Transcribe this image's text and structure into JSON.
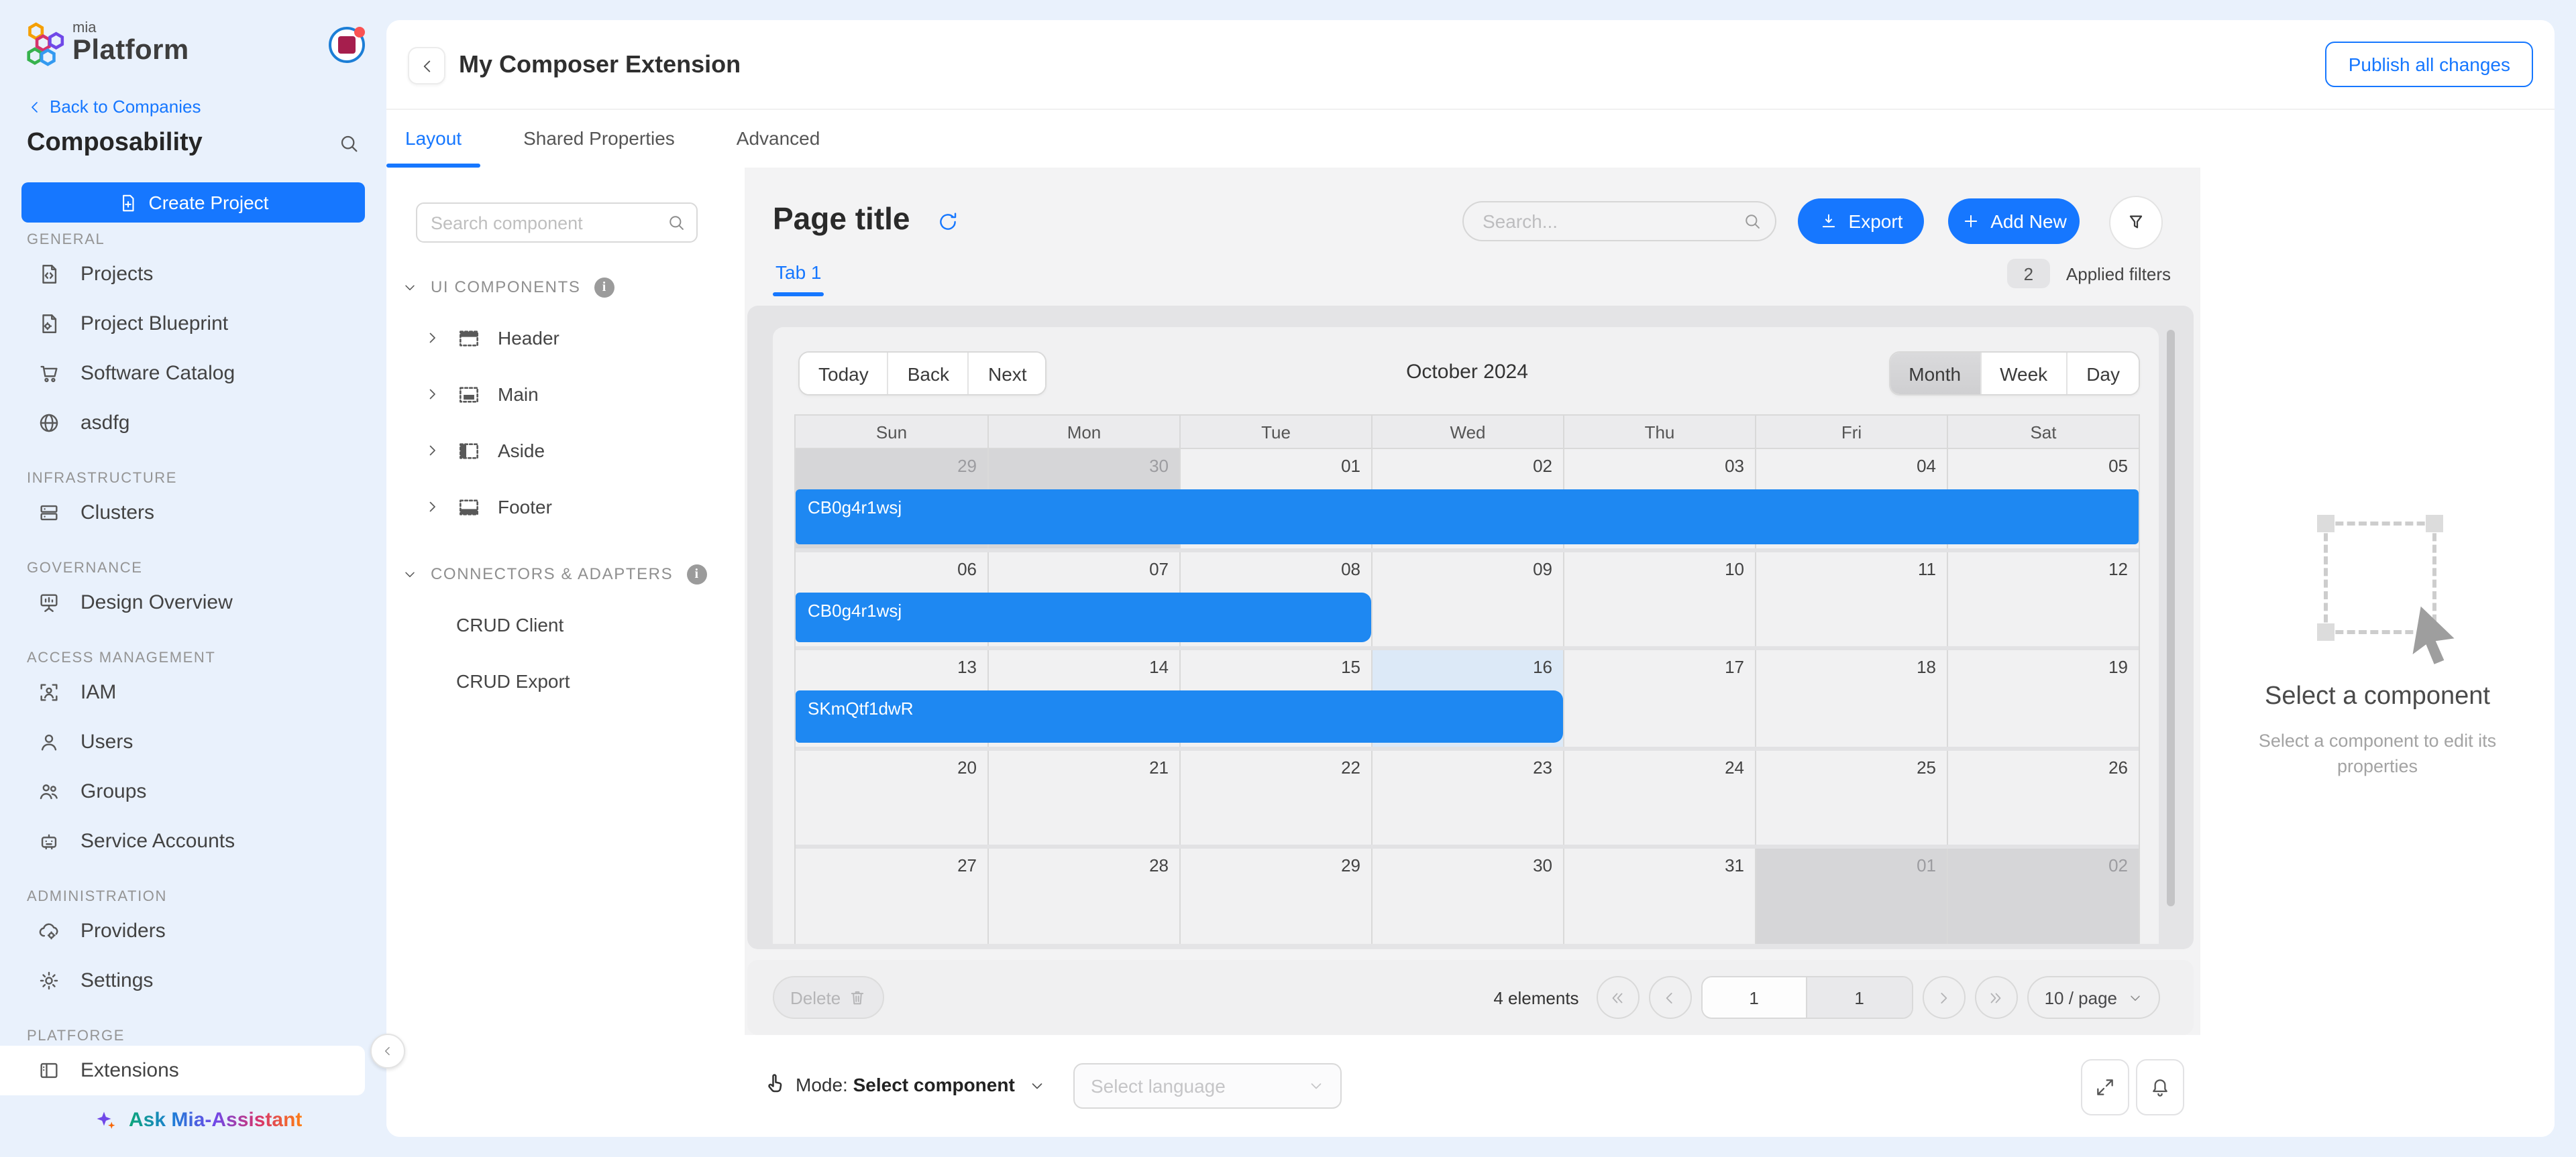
{
  "colors": {
    "accent": "#1677ff",
    "event_blue": "#1e88f2",
    "page_bg": "#e9f1fc",
    "today_cell": "#dce9f7"
  },
  "sidebar": {
    "logo": {
      "mia": "mia",
      "platform": "Platform"
    },
    "back_link": "Back to Companies",
    "company": "Composability",
    "create_project": "Create Project",
    "sections": [
      {
        "label": "GENERAL",
        "items": [
          {
            "label": "Projects",
            "icon": "file-code-icon"
          },
          {
            "label": "Project Blueprint",
            "icon": "file-gear-icon"
          },
          {
            "label": "Software Catalog",
            "icon": "cart-icon"
          },
          {
            "label": "asdfg",
            "icon": "globe-icon"
          }
        ]
      },
      {
        "label": "INFRASTRUCTURE",
        "items": [
          {
            "label": "Clusters",
            "icon": "server-icon"
          }
        ]
      },
      {
        "label": "GOVERNANCE",
        "items": [
          {
            "label": "Design Overview",
            "icon": "board-icon"
          }
        ]
      },
      {
        "label": "ACCESS MANAGEMENT",
        "items": [
          {
            "label": "IAM",
            "icon": "id-badge-icon"
          },
          {
            "label": "Users",
            "icon": "user-icon"
          },
          {
            "label": "Groups",
            "icon": "users-icon"
          },
          {
            "label": "Service Accounts",
            "icon": "robot-icon"
          }
        ]
      },
      {
        "label": "ADMINISTRATION",
        "items": [
          {
            "label": "Providers",
            "icon": "cloud-gear-icon"
          },
          {
            "label": "Settings",
            "icon": "gear-icon"
          }
        ]
      },
      {
        "label": "PLATFORGE",
        "items": [
          {
            "label": "Extensions",
            "icon": "layout-icon",
            "active": true
          }
        ]
      }
    ],
    "assistant": "Ask Mia-Assistant"
  },
  "header": {
    "title": "My Composer Extension",
    "publish_button": "Publish all changes"
  },
  "tabs": [
    {
      "label": "Layout",
      "active": true
    },
    {
      "label": "Shared Properties",
      "active": false
    },
    {
      "label": "Advanced",
      "active": false
    }
  ],
  "component_panel": {
    "search_placeholder": "Search component",
    "groups": [
      {
        "label": "UI COMPONENTS",
        "items": [
          {
            "label": "Header",
            "icon": "layout-header-icon",
            "expandable": true
          },
          {
            "label": "Main",
            "icon": "layout-main-icon",
            "expandable": true
          },
          {
            "label": "Aside",
            "icon": "layout-aside-icon",
            "expandable": true
          },
          {
            "label": "Footer",
            "icon": "layout-footer-icon",
            "expandable": true
          }
        ]
      },
      {
        "label": "CONNECTORS & ADAPTERS",
        "items": [
          {
            "label": "CRUD Client"
          },
          {
            "label": "CRUD Export"
          }
        ]
      }
    ]
  },
  "canvas": {
    "page_title": "Page title",
    "search_placeholder": "Search...",
    "export_button": "Export",
    "add_new_button": "Add New",
    "content_tab": "Tab 1",
    "applied_filters_count": "2",
    "applied_filters_label": "Applied filters"
  },
  "calendar": {
    "toolbar": {
      "today": "Today",
      "back": "Back",
      "next": "Next",
      "title": "October 2024",
      "views": [
        "Month",
        "Week",
        "Day"
      ],
      "active_view": "Month"
    },
    "weekdays": [
      "Sun",
      "Mon",
      "Tue",
      "Wed",
      "Thu",
      "Fri",
      "Sat"
    ],
    "weeks": [
      {
        "days": [
          {
            "d": "29",
            "outside": true
          },
          {
            "d": "30",
            "outside": true
          },
          {
            "d": "01"
          },
          {
            "d": "02"
          },
          {
            "d": "03"
          },
          {
            "d": "04"
          },
          {
            "d": "05"
          }
        ],
        "events": [
          {
            "label": "CB0g4r1wsj",
            "start": 0,
            "span": 7,
            "rounded_right": false
          }
        ]
      },
      {
        "days": [
          {
            "d": "06"
          },
          {
            "d": "07"
          },
          {
            "d": "08"
          },
          {
            "d": "09"
          },
          {
            "d": "10"
          },
          {
            "d": "11"
          },
          {
            "d": "12"
          }
        ],
        "events": [
          {
            "label": "CB0g4r1wsj",
            "start": 0,
            "span": 3,
            "rounded_right": true
          }
        ]
      },
      {
        "days": [
          {
            "d": "13"
          },
          {
            "d": "14"
          },
          {
            "d": "15"
          },
          {
            "d": "16",
            "today": true
          },
          {
            "d": "17"
          },
          {
            "d": "18"
          },
          {
            "d": "19"
          }
        ],
        "events": [
          {
            "label": "SKmQtf1dwR",
            "start": 0,
            "span": 4,
            "rounded_right": true
          }
        ]
      },
      {
        "days": [
          {
            "d": "20"
          },
          {
            "d": "21"
          },
          {
            "d": "22"
          },
          {
            "d": "23"
          },
          {
            "d": "24"
          },
          {
            "d": "25"
          },
          {
            "d": "26"
          }
        ],
        "events": []
      },
      {
        "days": [
          {
            "d": "27"
          },
          {
            "d": "28"
          },
          {
            "d": "29"
          },
          {
            "d": "30"
          },
          {
            "d": "31"
          },
          {
            "d": "01",
            "outside": true
          },
          {
            "d": "02",
            "outside": true
          }
        ],
        "events": []
      }
    ]
  },
  "table_footer": {
    "delete_button": "Delete",
    "elements_count": "4 elements",
    "current_page": "1",
    "total_pages": "1",
    "page_size": "10 / page"
  },
  "mode_bar": {
    "mode_label": "Mode:",
    "mode_value": "Select component",
    "language_placeholder": "Select language"
  },
  "inspector": {
    "title": "Select a component",
    "subtitle": "Select a component to edit its properties"
  }
}
